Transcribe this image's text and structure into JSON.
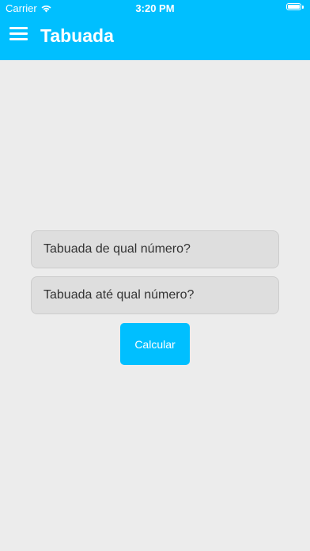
{
  "status_bar": {
    "carrier": "Carrier",
    "time": "3:20 PM",
    "wifi_icon": "wifi-icon",
    "battery_icon": "battery-icon"
  },
  "app_bar": {
    "menu_icon": "hamburger-menu-icon",
    "title": "Tabuada",
    "background_color": "#00bfff"
  },
  "form": {
    "number_field": {
      "value": "",
      "placeholder": "Tabuada de qual número?"
    },
    "limit_field": {
      "value": "",
      "placeholder": "Tabuada até qual número?"
    },
    "calculate_label": "Calcular"
  },
  "colors": {
    "accent": "#00bfff",
    "background": "#ececec",
    "field_background": "#dedede",
    "text": "#333333"
  }
}
